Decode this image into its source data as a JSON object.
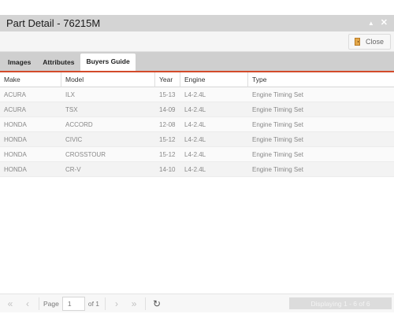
{
  "window": {
    "title": "Part Detail - 76215M",
    "collapse_icon": "caret-up-icon",
    "close_icon": "close-x-icon"
  },
  "toolbar": {
    "close_label": "Close"
  },
  "tabs": [
    {
      "label": "Images",
      "active": false
    },
    {
      "label": "Attributes",
      "active": false
    },
    {
      "label": "Buyers Guide",
      "active": true
    }
  ],
  "grid": {
    "columns": [
      "Make",
      "Model",
      "Year",
      "Engine",
      "Type"
    ],
    "rows": [
      {
        "make": "ACURA",
        "model": "ILX",
        "year": "15-13",
        "engine": "L4-2.4L",
        "type": "Engine Timing Set"
      },
      {
        "make": "ACURA",
        "model": "TSX",
        "year": "14-09",
        "engine": "L4-2.4L",
        "type": "Engine Timing Set"
      },
      {
        "make": "HONDA",
        "model": "ACCORD",
        "year": "12-08",
        "engine": "L4-2.4L",
        "type": "Engine Timing Set"
      },
      {
        "make": "HONDA",
        "model": "CIVIC",
        "year": "15-12",
        "engine": "L4-2.4L",
        "type": "Engine Timing Set"
      },
      {
        "make": "HONDA",
        "model": "CROSSTOUR",
        "year": "15-12",
        "engine": "L4-2.4L",
        "type": "Engine Timing Set"
      },
      {
        "make": "HONDA",
        "model": "CR-V",
        "year": "14-10",
        "engine": "L4-2.4L",
        "type": "Engine Timing Set"
      }
    ]
  },
  "pager": {
    "page_label": "Page",
    "page_value": "1",
    "of_label": "of 1",
    "display_text": "Displaying 1 - 6 of 6"
  },
  "colors": {
    "accent": "#d34a2a",
    "titlebar": "#d4d4d4",
    "tabbar": "#cfcfcf"
  }
}
